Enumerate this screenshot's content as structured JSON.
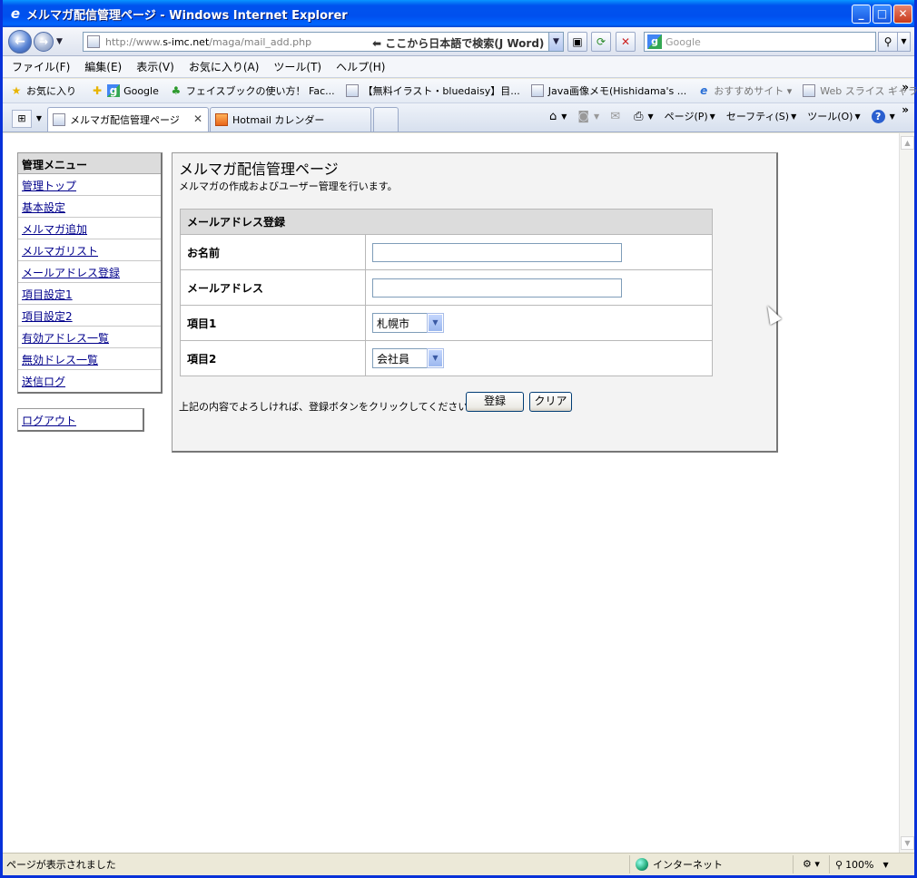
{
  "window": {
    "title": "メルマガ配信管理ページ - Windows Internet Explorer",
    "buttons": {
      "minimize": "_",
      "maximize": "□",
      "close": "✕"
    }
  },
  "address": {
    "url_prefix": "http://www.",
    "url_host": "s-imc.net",
    "url_path": "/maga/mail_add.php",
    "hint": "⬅ ここから日本語で検索(J Word)",
    "search_placeholder": "Google"
  },
  "menu": [
    "ファイル(F)",
    "編集(E)",
    "表示(V)",
    "お気に入り(A)",
    "ツール(T)",
    "ヘルプ(H)"
  ],
  "favorites": {
    "label": "お気に入り",
    "items": [
      {
        "label": "Google",
        "icon": "google-icon"
      },
      {
        "label": "フェイスブックの使い方！ Fac...",
        "icon": "clover-icon"
      },
      {
        "label": "【無料イラスト・bluedaisy】目...",
        "icon": "ie-page-icon"
      },
      {
        "label": "Java画像メモ(Hishidama's ...",
        "icon": "ie-page-icon"
      },
      {
        "label": "おすすめサイト ▾",
        "icon": "ie-icon"
      },
      {
        "label": "Web スライス ギャラリー ▾",
        "icon": "ie-page-icon"
      }
    ],
    "more": "»"
  },
  "tabs": [
    {
      "label": "メルマガ配信管理ページ",
      "active": true
    },
    {
      "label": "Hotmail カレンダー",
      "active": false
    }
  ],
  "commands": [
    {
      "icon": "home-icon",
      "glyph": "⌂",
      "label": ""
    },
    {
      "icon": "rss-icon",
      "glyph": "◙",
      "label": ""
    },
    {
      "icon": "mail-icon",
      "glyph": "✉",
      "label": ""
    },
    {
      "icon": "print-icon",
      "glyph": "⎙",
      "label": ""
    },
    {
      "icon": "",
      "glyph": "",
      "label": "ページ(P)"
    },
    {
      "icon": "",
      "glyph": "",
      "label": "セーフティ(S)"
    },
    {
      "icon": "",
      "glyph": "",
      "label": "ツール(O)"
    },
    {
      "icon": "help-icon",
      "glyph": "?",
      "label": ""
    }
  ],
  "sidemenu": {
    "title": "管理メニュー",
    "items": [
      "管理トップ",
      "基本設定",
      "メルマガ追加",
      "メルマガリスト",
      "メールアドレス登録",
      "項目設定1",
      "項目設定2",
      "有効アドレス一覧",
      "無効ドレス一覧",
      "送信ログ"
    ],
    "logout": "ログアウト"
  },
  "panel": {
    "title": "メルマガ配信管理ページ",
    "description": "メルマガの作成およびユーザー管理を行います。",
    "table_caption": "メールアドレス登録",
    "fields": {
      "name_label": "お名前",
      "name_value": "",
      "email_label": "メールアドレス",
      "email_value": "",
      "item1_label": "項目1",
      "item1_value": "札幌市",
      "item2_label": "項目2",
      "item2_value": "会社員"
    },
    "note": "上記の内容でよろしければ、登録ボタンをクリックしてください。",
    "submit_label": "登録",
    "clear_label": "クリア"
  },
  "status": {
    "text": "ページが表示されました",
    "zone": "インターネット",
    "zoom": "100%"
  }
}
